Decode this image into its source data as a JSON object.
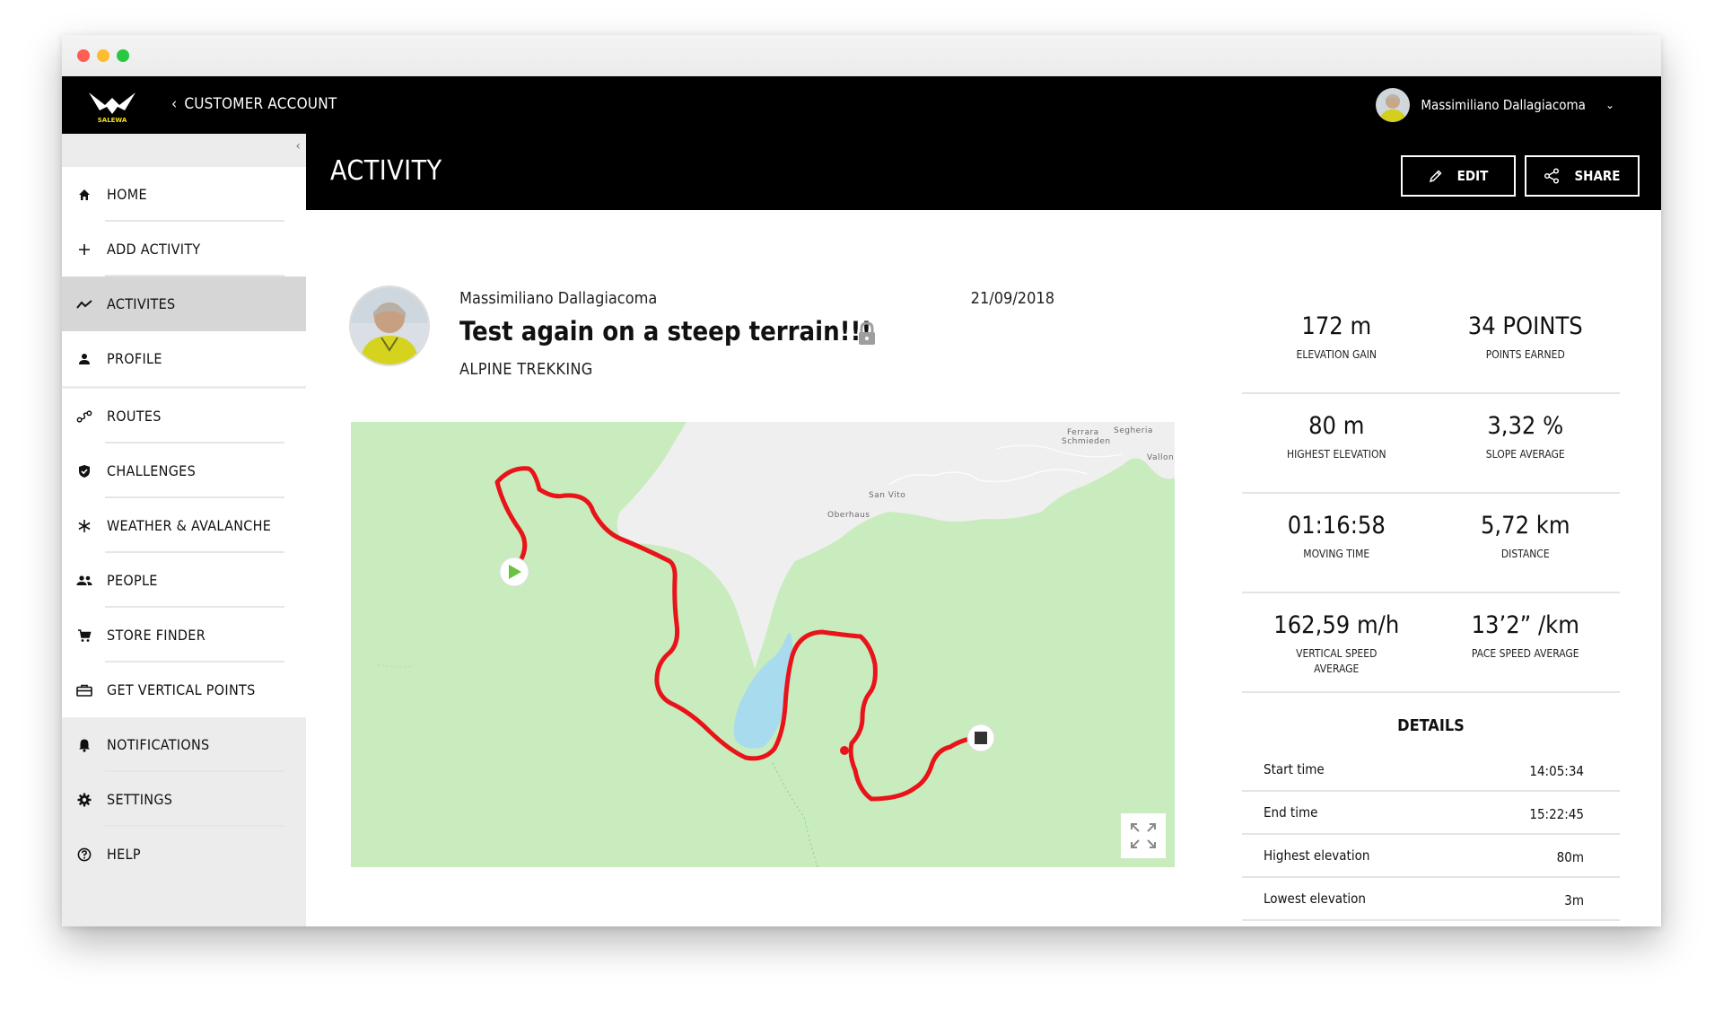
{
  "topbar": {
    "back_label": "CUSTOMER ACCOUNT",
    "brand_text": "SALEWA",
    "user_name": "Massimiliano Dallagiacoma"
  },
  "sidebar": {
    "items": [
      {
        "label": "HOME",
        "icon": "home-icon"
      },
      {
        "label": "ADD ACTIVITY",
        "icon": "plus-icon"
      },
      {
        "label": "ACTIVITES",
        "icon": "activity-chart-icon",
        "active": true
      },
      {
        "label": "PROFILE",
        "icon": "person-icon"
      },
      {
        "label": "ROUTES",
        "icon": "route-icon"
      },
      {
        "label": "CHALLENGES",
        "icon": "shield-check-icon"
      },
      {
        "label": "WEATHER & AVALANCHE",
        "icon": "snowflake-icon"
      },
      {
        "label": "PEOPLE",
        "icon": "people-icon"
      },
      {
        "label": "STORE FINDER",
        "icon": "cart-icon"
      },
      {
        "label": "GET VERTICAL POINTS",
        "icon": "briefcase-icon"
      },
      {
        "label": "NOTIFICATIONS",
        "icon": "bell-icon"
      },
      {
        "label": "SETTINGS",
        "icon": "gear-icon"
      },
      {
        "label": "HELP",
        "icon": "help-icon"
      }
    ]
  },
  "header": {
    "title": "ACTIVITY",
    "edit_label": "EDIT",
    "share_label": "SHARE"
  },
  "post": {
    "author": "Massimiliano Dallagiacoma",
    "date": "21/09/2018",
    "title": "Test again on a steep terrain!!!",
    "activity_type": "ALPINE TREKKING"
  },
  "map": {
    "place_labels": [
      "Ferrara",
      "Schmieden",
      "Segheria",
      "Vallon",
      "San Vito",
      "Oberhaus"
    ],
    "route_color": "#e8141a",
    "land_color": "#c8ecbd",
    "valley_color": "#efefef",
    "lake_color": "#a9dbee"
  },
  "stats": [
    {
      "value": "172 m",
      "label": "ELEVATION GAIN"
    },
    {
      "value": "34 POINTS",
      "label": "POINTS EARNED"
    },
    {
      "value": "80 m",
      "label": "HIGHEST ELEVATION"
    },
    {
      "value": "3,32 %",
      "label": "SLOPE AVERAGE"
    },
    {
      "value": "01:16:58",
      "label": "MOVING TIME"
    },
    {
      "value": "5,72 km",
      "label": "DISTANCE"
    },
    {
      "value": "162,59 m/h",
      "label": "VERTICAL SPEED AVERAGE"
    },
    {
      "value": "13’2” /km",
      "label": "PACE SPEED AVERAGE"
    }
  ],
  "details": {
    "title": "DETAILS",
    "rows": [
      {
        "label": "Start time",
        "value": "14:05:34"
      },
      {
        "label": "End time",
        "value": "15:22:45"
      },
      {
        "label": "Highest elevation",
        "value": "80m"
      },
      {
        "label": "Lowest elevation",
        "value": "3m"
      }
    ]
  }
}
